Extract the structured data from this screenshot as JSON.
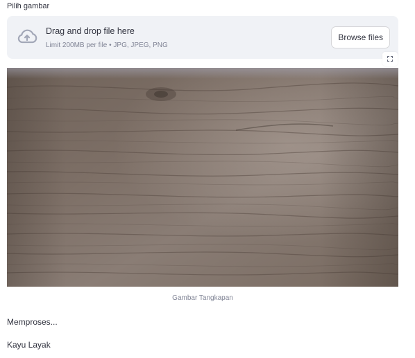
{
  "uploader": {
    "label": "Pilih gambar",
    "drop_title": "Drag and drop file here",
    "limit_text": "Limit 200MB per file • JPG, JPEG, PNG",
    "browse_button": "Browse files",
    "cloud_icon": "cloud-upload-icon",
    "fullscreen_icon": "fullscreen-icon"
  },
  "image": {
    "caption": "Gambar Tangkapan"
  },
  "status": {
    "processing": "Memproses...",
    "result": "Kayu Layak"
  },
  "colors": {
    "dropzone_bg": "#f0f2f6",
    "text": "#31333f",
    "muted": "#808495",
    "icon": "#a3a8b8"
  }
}
